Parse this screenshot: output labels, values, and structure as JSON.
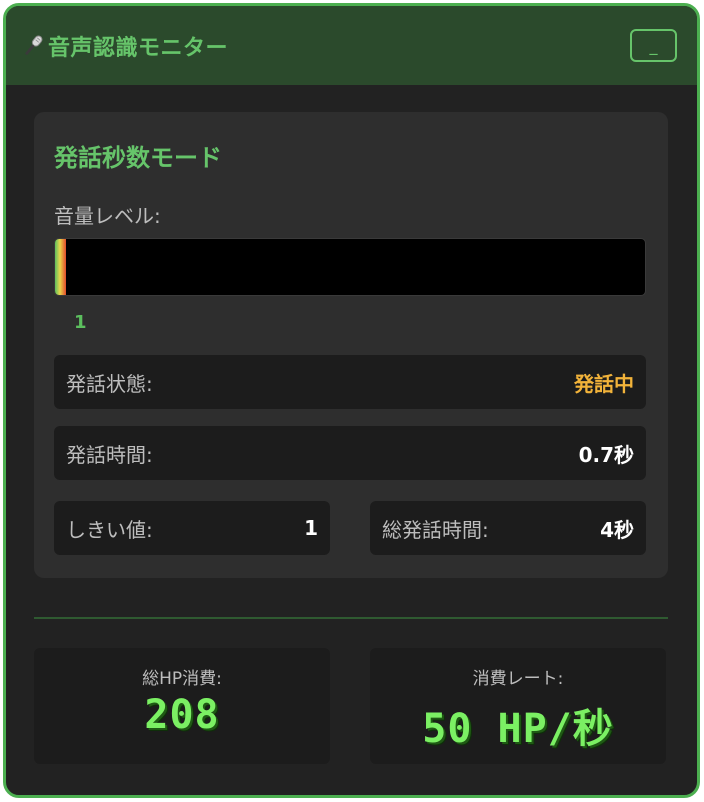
{
  "window": {
    "title": "音声認識モニター",
    "minimize_label": "_",
    "accent_color": "#4caf50",
    "title_icon": "microphone-icon"
  },
  "panel": {
    "mode_title": "発話秒数モード",
    "volume_label": "音量レベル:",
    "volume_value": "1",
    "volume_fraction": 0.01,
    "speech_state_label": "発話状態:",
    "speech_state_value": "発話中",
    "speech_time_label": "発話時間:",
    "speech_time_value": "0.7秒",
    "threshold_label": "しきい値:",
    "threshold_value": "1",
    "total_speech_label": "総発話時間:",
    "total_speech_value": "4秒"
  },
  "stats": {
    "total_hp_label": "総HP消費:",
    "total_hp_value": "208",
    "rate_label": "消費レート:",
    "rate_value": "50 HP/秒"
  }
}
